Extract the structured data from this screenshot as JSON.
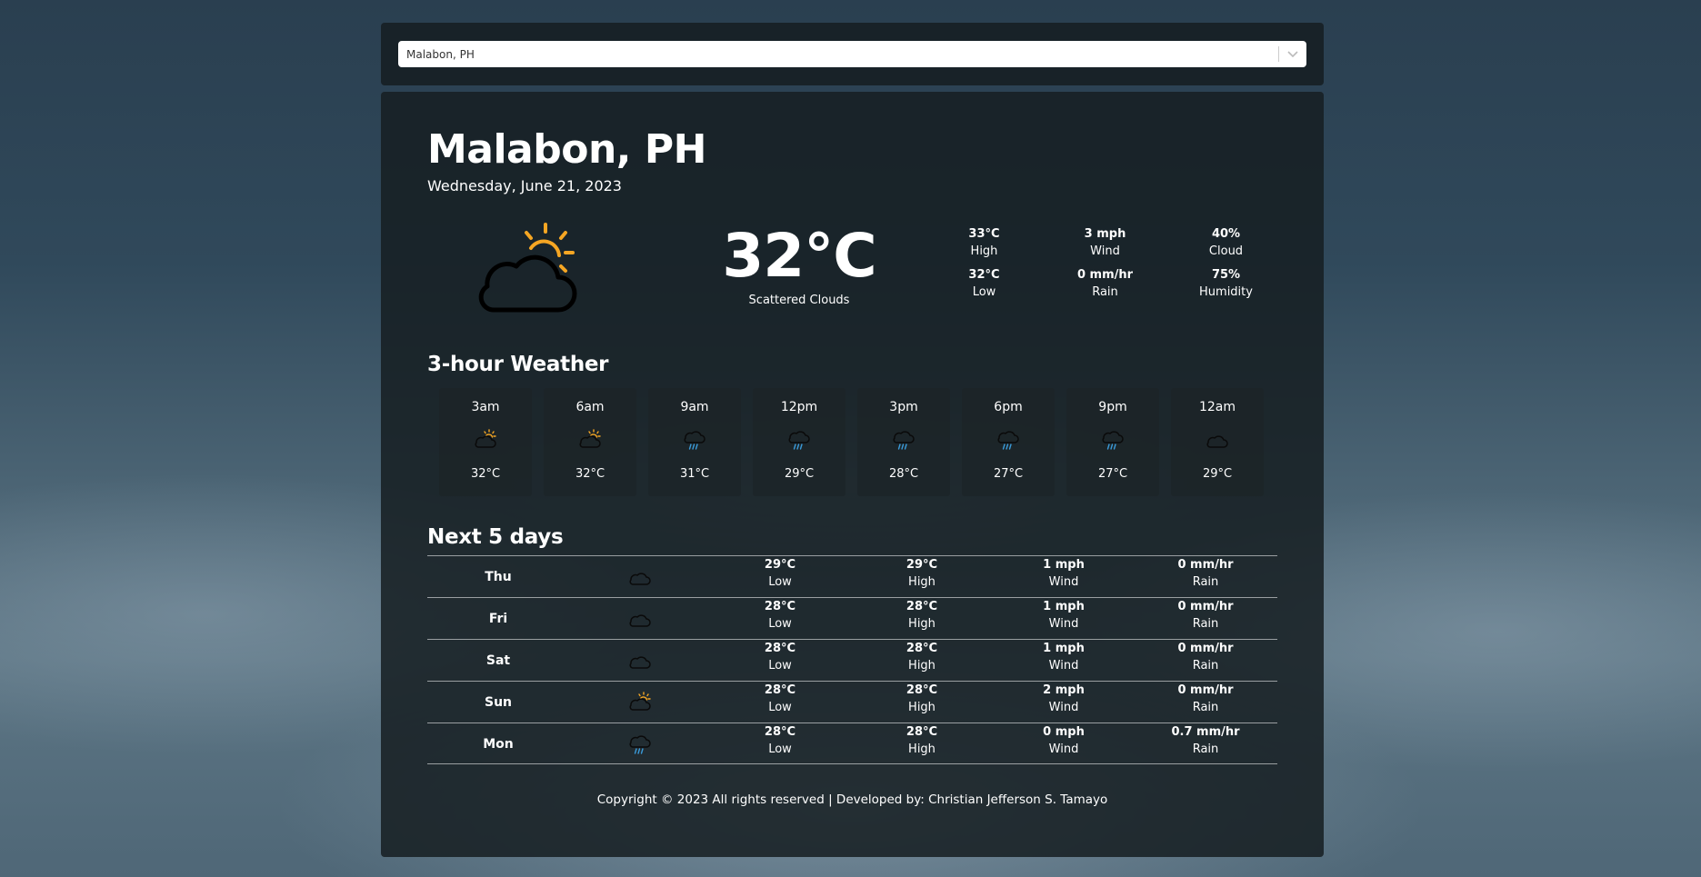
{
  "search": {
    "selected": "Malabon, PH"
  },
  "current": {
    "city": "Malabon, PH",
    "date": "Wednesday, June 21, 2023",
    "icon": "cloud-sun-icon",
    "temp": "32°C",
    "description": "Scattered Clouds",
    "stats": [
      {
        "value": "33°C",
        "label": "High"
      },
      {
        "value": "3 mph",
        "label": "Wind"
      },
      {
        "value": "40%",
        "label": "Cloud"
      },
      {
        "value": "32°C",
        "label": "Low"
      },
      {
        "value": "0 mm/hr",
        "label": "Rain"
      },
      {
        "value": "75%",
        "label": "Humidity"
      }
    ]
  },
  "hourly_title": "3-hour Weather",
  "hourly": [
    {
      "time": "3am",
      "icon": "cloud-sun-icon",
      "temp": "32°C"
    },
    {
      "time": "6am",
      "icon": "cloud-sun-icon",
      "temp": "32°C"
    },
    {
      "time": "9am",
      "icon": "cloud-rain-icon",
      "temp": "31°C"
    },
    {
      "time": "12pm",
      "icon": "cloud-rain-icon",
      "temp": "29°C"
    },
    {
      "time": "3pm",
      "icon": "cloud-rain-icon",
      "temp": "28°C"
    },
    {
      "time": "6pm",
      "icon": "cloud-rain-icon",
      "temp": "27°C"
    },
    {
      "time": "9pm",
      "icon": "cloud-rain-icon",
      "temp": "27°C"
    },
    {
      "time": "12am",
      "icon": "cloud-icon",
      "temp": "29°C"
    }
  ],
  "daily_title": "Next 5 days",
  "daily": [
    {
      "day": "Thu",
      "icon": "cloud-icon",
      "low": "29°C",
      "high": "29°C",
      "wind": "1 mph",
      "rain": "0 mm/hr"
    },
    {
      "day": "Fri",
      "icon": "cloud-icon",
      "low": "28°C",
      "high": "28°C",
      "wind": "1 mph",
      "rain": "0 mm/hr"
    },
    {
      "day": "Sat",
      "icon": "cloud-icon",
      "low": "28°C",
      "high": "28°C",
      "wind": "1 mph",
      "rain": "0 mm/hr"
    },
    {
      "day": "Sun",
      "icon": "cloud-sun-icon",
      "low": "28°C",
      "high": "28°C",
      "wind": "2 mph",
      "rain": "0 mm/hr"
    },
    {
      "day": "Mon",
      "icon": "cloud-rain-icon",
      "low": "28°C",
      "high": "28°C",
      "wind": "0 mph",
      "rain": "0.7 mm/hr"
    }
  ],
  "daily_labels": {
    "low": "Low",
    "high": "High",
    "wind": "Wind",
    "rain": "Rain"
  },
  "footer": "Copyright © 2023 All rights reserved | Developed by: Christian Jefferson S. Tamayo",
  "colors": {
    "sun": "#f5a623",
    "rain": "#3a9ad9",
    "card": "#161e22"
  }
}
